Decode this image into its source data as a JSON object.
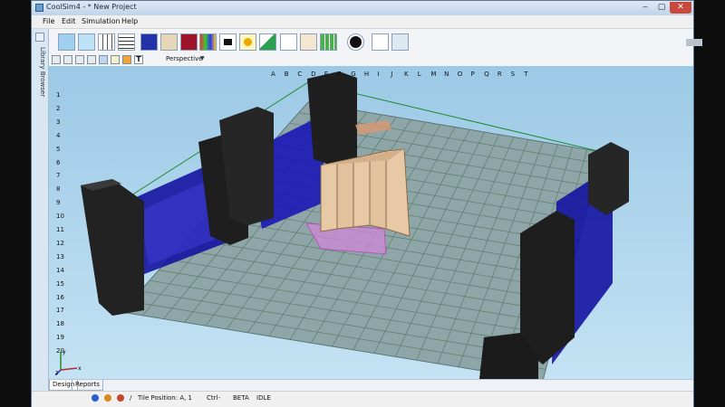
{
  "window": {
    "title": "CoolSim4 - * New Project",
    "buttons": {
      "minimize": "‒",
      "maximize": "▢",
      "close": "✕"
    }
  },
  "menu": [
    "File",
    "Edit",
    "Simulation",
    "Help"
  ],
  "sidebar": {
    "label": "Library Browser"
  },
  "toolbar": {
    "icons": [
      "single-tile-icon",
      "split-view-icon",
      "grid-view-icon",
      "server-list-icon",
      "blue-rack-icon",
      "door-rack-icon",
      "red-rack-icon",
      "color-palette-icon",
      "black-box-icon",
      "sun-icon",
      "grid-chart-icon",
      "bracket-icon",
      "server-panel-icon",
      "green-grid-icon",
      "clock-icon",
      "line-chart-icon",
      "report-icon"
    ]
  },
  "subtoolbar": {
    "icons": [
      "lock-icon",
      "save-icon",
      "home-icon",
      "zoom-fit-icon",
      "camera-icon",
      "light-icon",
      "orange-icon",
      "text-icon"
    ],
    "view_mode": "Perspective"
  },
  "grid": {
    "columns": [
      "A",
      "B",
      "C",
      "D",
      "E",
      "F",
      "G",
      "H",
      "I",
      "J",
      "K",
      "L",
      "M",
      "N",
      "O",
      "P",
      "Q",
      "R",
      "S",
      "T"
    ],
    "rows": [
      "1",
      "2",
      "3",
      "4",
      "5",
      "6",
      "7",
      "8",
      "9",
      "10",
      "11",
      "12",
      "13",
      "14",
      "15",
      "16",
      "17",
      "18",
      "19",
      "20"
    ]
  },
  "axes": {
    "x": "x",
    "y": "y",
    "z": "z"
  },
  "tabs": [
    "Design",
    "Reports"
  ],
  "status": {
    "tile_position": "Tile Position: A, 1",
    "ctrl": "Ctrl-",
    "beta": "BETA",
    "state": "IDLE"
  },
  "colors": {
    "wall_blue": "#1414a0",
    "floor": "#8fa6a8",
    "rack": "#e8c9a5",
    "tile_highlight": "#d088d8",
    "ceiling_line": "#1b8a2b"
  }
}
